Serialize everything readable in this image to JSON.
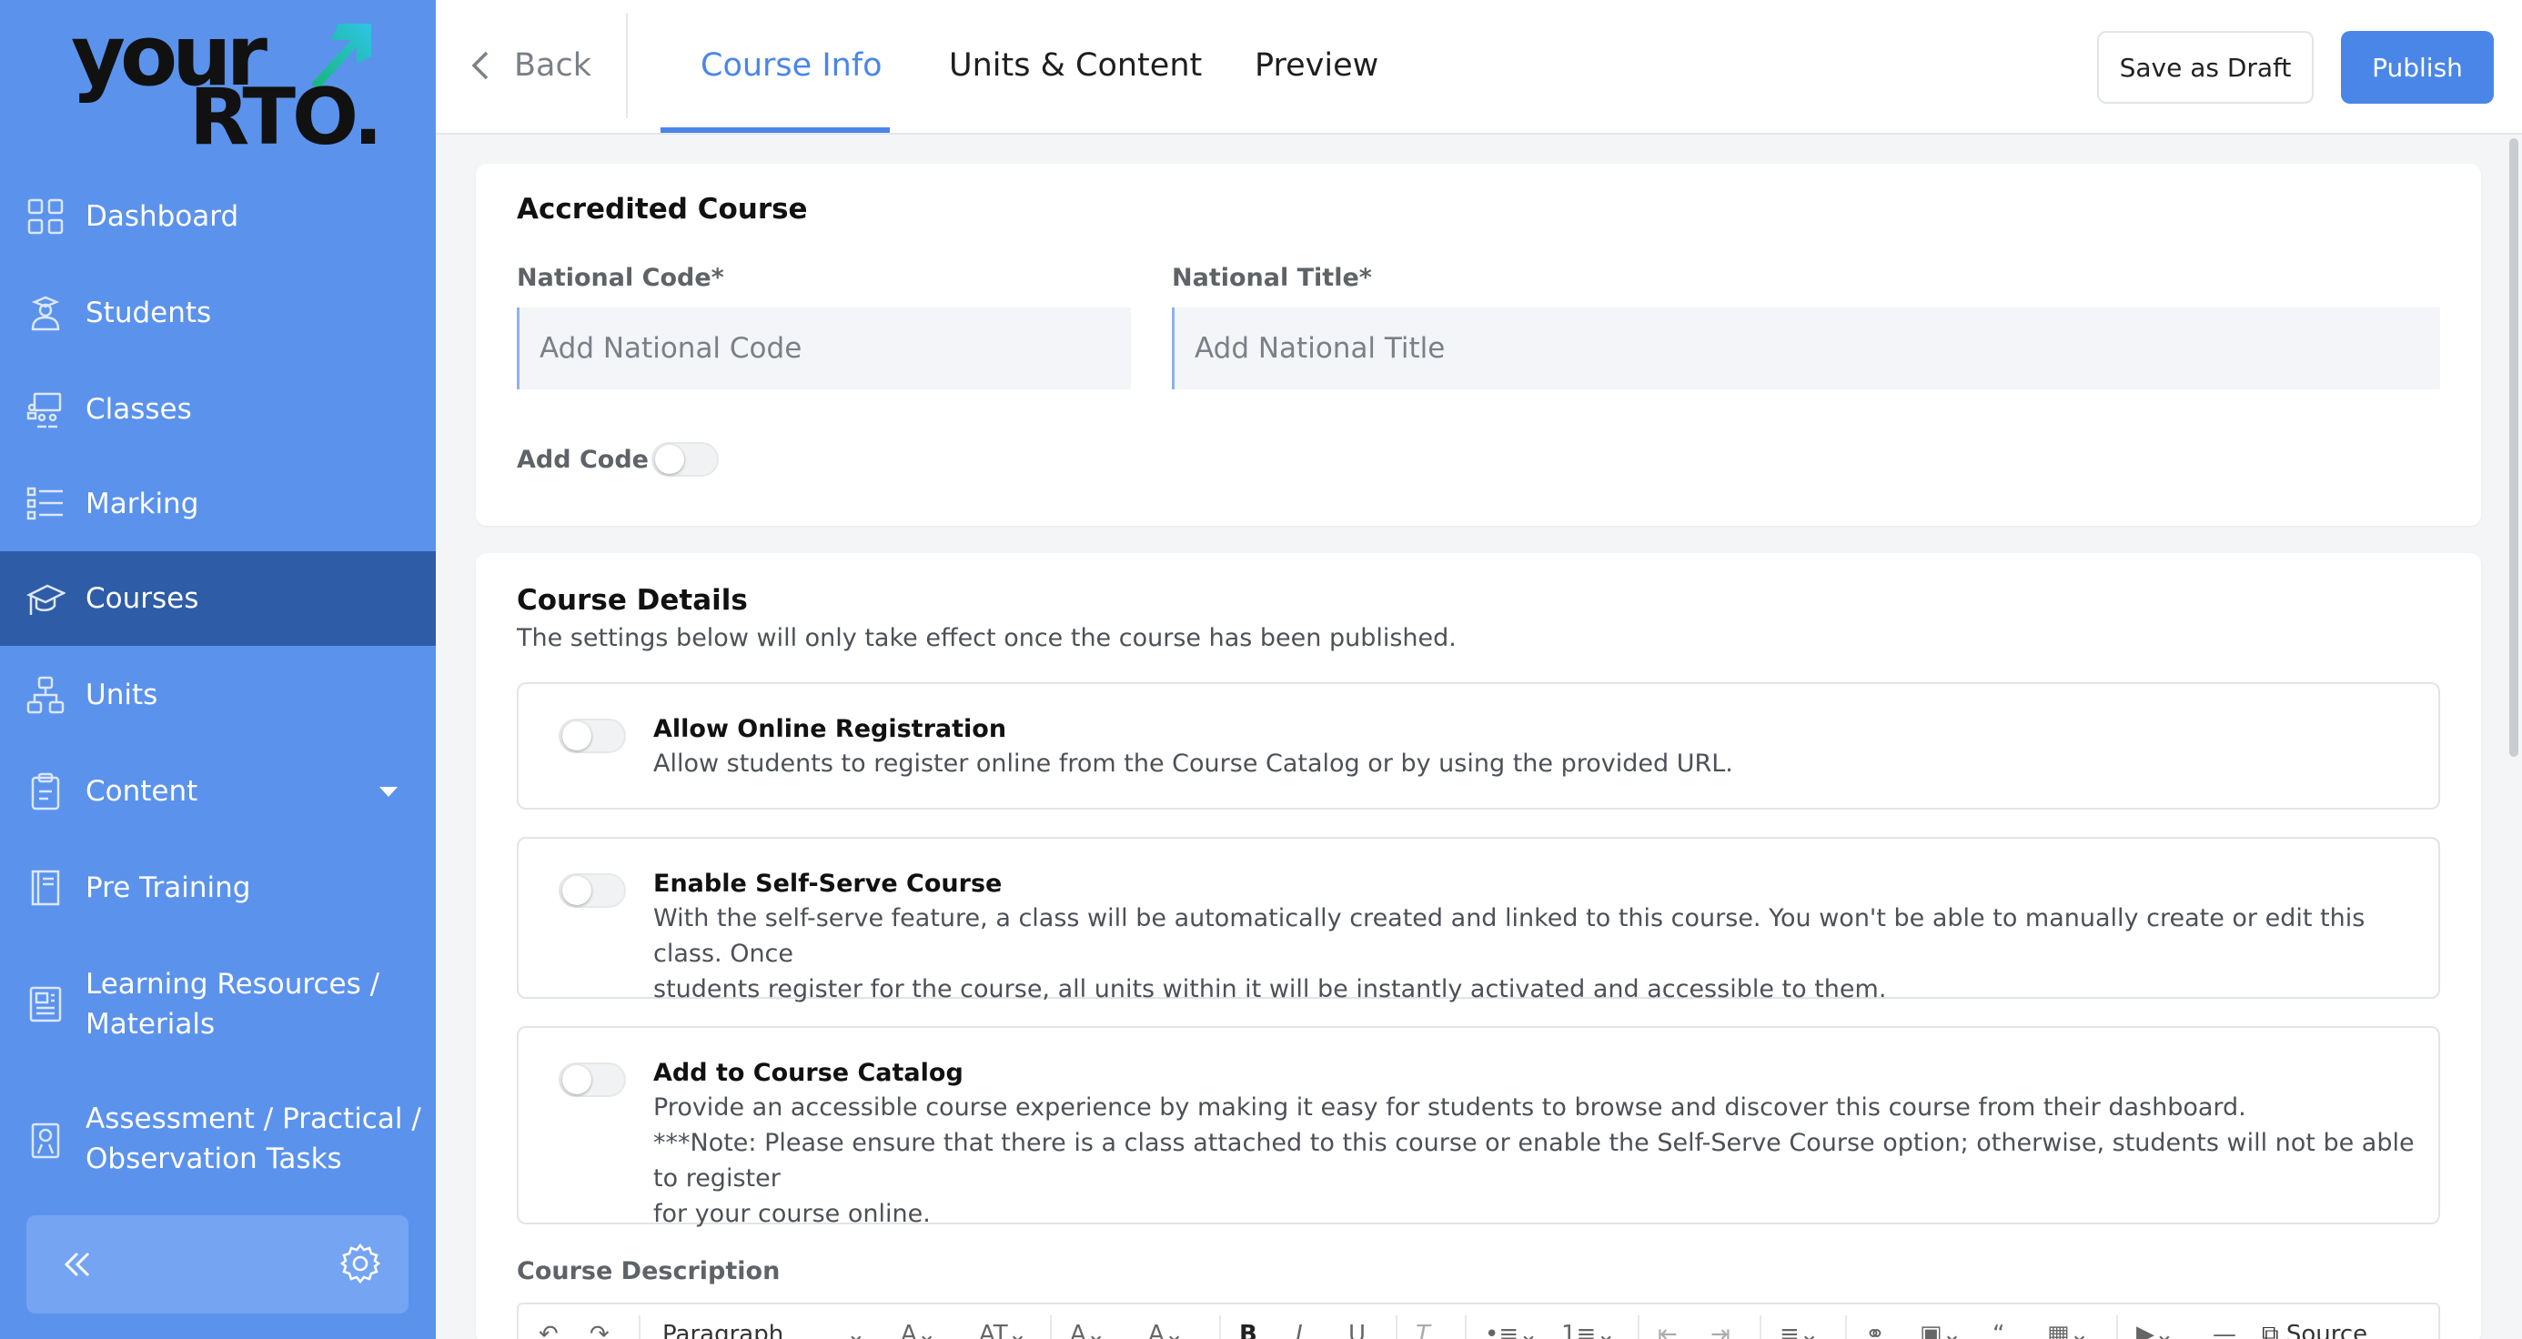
{
  "brand": {
    "logo_line1": "your",
    "logo_line2": "RTO.",
    "accent": "#2ec4e6"
  },
  "sidebar": {
    "items": [
      {
        "label": "Dashboard",
        "icon": "dashboard-grid-icon"
      },
      {
        "label": "Students",
        "icon": "student-icon"
      },
      {
        "label": "Classes",
        "icon": "classroom-icon"
      },
      {
        "label": "Marking",
        "icon": "checklist-icon"
      },
      {
        "label": "Courses",
        "icon": "graduation-icon",
        "active": true
      },
      {
        "label": "Units",
        "icon": "hierarchy-icon"
      },
      {
        "label": "Content",
        "icon": "clipboard-icon"
      },
      {
        "label": "Pre Training",
        "icon": "book-icon"
      },
      {
        "label_line1": "Learning Resources /",
        "label_line2": "Materials",
        "icon": "document-icon"
      },
      {
        "label_line1": "Assessment / Practical /",
        "label_line2": "Observation Tasks",
        "icon": "assessment-icon"
      }
    ]
  },
  "topbar": {
    "back_label": "Back",
    "tabs": [
      {
        "label": "Course Info",
        "active": true
      },
      {
        "label": "Units & Content"
      },
      {
        "label": "Preview"
      }
    ],
    "save_draft_label": "Save as Draft",
    "publish_label": "Publish"
  },
  "accredited": {
    "title": "Accredited Course",
    "national_code_label": "National Code*",
    "national_code_placeholder": "Add National Code",
    "national_title_label": "National Title*",
    "national_title_placeholder": "Add National Title",
    "add_code_label": "Add Code"
  },
  "details": {
    "title": "Course Details",
    "subtitle": "The settings below will only take effect once the course has been published.",
    "options": [
      {
        "title": "Allow Online Registration",
        "desc": [
          "Allow students to register online from the Course Catalog or by using the provided URL."
        ]
      },
      {
        "title": "Enable Self-Serve Course",
        "desc": [
          "With the self-serve feature, a class will be automatically created and linked to this course. You won't be able to manually create or edit this class. Once",
          "students register for the course, all units within it will be instantly activated and accessible to them."
        ]
      },
      {
        "title": "Add to Course Catalog",
        "desc": [
          "Provide an accessible course experience by making it easy for students to browse and discover this course from their dashboard.",
          "***Note: Please ensure that there is a class attached to this course or enable the Self-Serve Course option; otherwise, students will not be able to register",
          "for your course online."
        ]
      }
    ],
    "description_label": "Course Description",
    "editor": {
      "paragraph_label": "Paragraph",
      "source_label": "Source"
    }
  }
}
